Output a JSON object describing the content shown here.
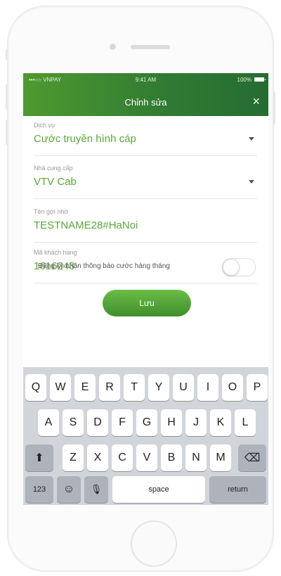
{
  "status_bar": {
    "carrier": "•••○○ VNPAY",
    "time": "9:41 AM",
    "battery": "100%"
  },
  "header": {
    "title": "Chỉnh sửa",
    "close_icon": "×"
  },
  "fields": [
    {
      "label": "Dịch vụ",
      "value": "Cước truyền hình cáp",
      "dropdown": true
    },
    {
      "label": "Nhà cung cấp",
      "value": "VTV Cab",
      "dropdown": true
    },
    {
      "label": "Tên gợi nhớ",
      "value": "TESTNAME28#HaNoi",
      "dropdown": false
    },
    {
      "label": "Mã khách hàng",
      "value": "1616243",
      "dropdown": false
    }
  ],
  "notify": {
    "label": "Đăng ký nhận thông báo cước hàng tháng",
    "enabled": false
  },
  "save_label": "Lưu",
  "keyboard": {
    "row1": [
      "Q",
      "W",
      "E",
      "R",
      "T",
      "Y",
      "U",
      "I",
      "O",
      "P"
    ],
    "row2": [
      "A",
      "S",
      "D",
      "F",
      "G",
      "H",
      "J",
      "K",
      "L"
    ],
    "row3": [
      "Z",
      "X",
      "C",
      "V",
      "B",
      "N",
      "M"
    ],
    "shift_icon": "⬆",
    "delete_icon": "⌫",
    "numbers_label": "123",
    "emoji_icon": "☺",
    "mic_icon": "🎙",
    "space_label": "space",
    "return_label": "return"
  },
  "colors": {
    "accent": "#5aa83a",
    "header_start": "#4f9a2f",
    "header_end": "#256c31"
  }
}
